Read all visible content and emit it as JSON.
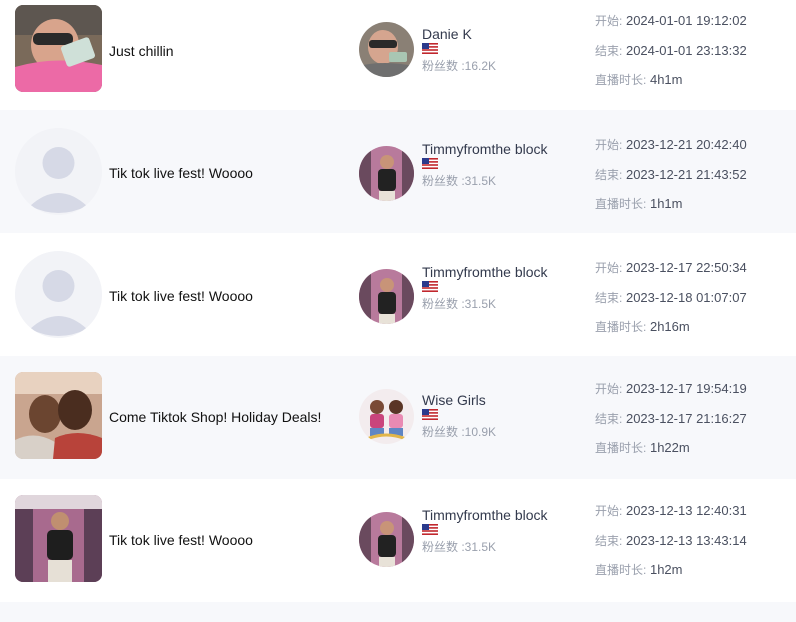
{
  "labels": {
    "start": "开始:",
    "end": "结束:",
    "duration": "直播时长:"
  },
  "rows": [
    {
      "title": "Just chillin",
      "host": "Danie K",
      "fans": "粉丝数 :16.2K",
      "start": "2024-01-01 19:12:02",
      "end": "2024-01-01 23:13:32",
      "duration": "4h1m"
    },
    {
      "title": "Tik tok live fest! Woooo",
      "host": "Timmyfromthe block",
      "fans": "粉丝数 :31.5K",
      "start": "2023-12-21 20:42:40",
      "end": "2023-12-21 21:43:52",
      "duration": "1h1m"
    },
    {
      "title": "Tik tok live fest! Woooo",
      "host": "Timmyfromthe block",
      "fans": "粉丝数 :31.5K",
      "start": "2023-12-17 22:50:34",
      "end": "2023-12-18 01:07:07",
      "duration": "2h16m"
    },
    {
      "title": "Come Tiktok Shop! Holiday Deals!",
      "host": "Wise Girls",
      "fans": "粉丝数 :10.9K",
      "start": "2023-12-17 19:54:19",
      "end": "2023-12-17 21:16:27",
      "duration": "1h22m"
    },
    {
      "title": "Tik tok live fest! Woooo",
      "host": "Timmyfromthe block",
      "fans": "粉丝数 :31.5K",
      "start": "2023-12-13 12:40:31",
      "end": "2023-12-13 13:43:14",
      "duration": "1h2m"
    }
  ]
}
